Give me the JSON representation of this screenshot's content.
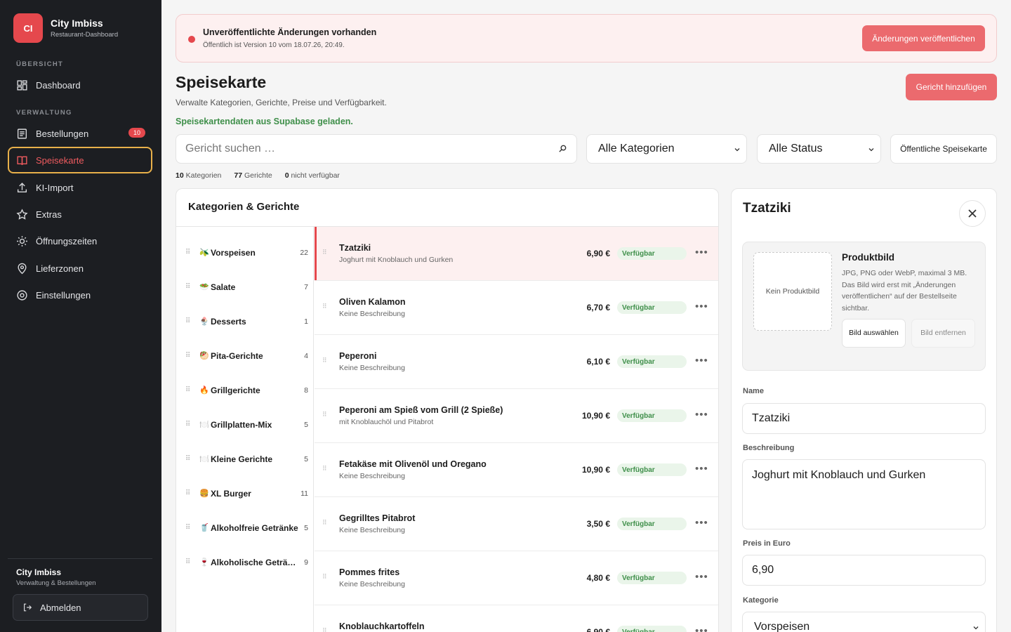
{
  "brand": {
    "logo": "CI",
    "name": "City Imbiss",
    "subtitle": "Restaurant-Dashboard"
  },
  "sidebar": {
    "section_overview": "ÜBERSICHT",
    "section_admin": "VERWALTUNG",
    "items": [
      {
        "label": "Dashboard",
        "icon": "dashboard-icon"
      },
      {
        "label": "Bestellungen",
        "icon": "receipt-icon",
        "badge": "10"
      },
      {
        "label": "Speisekarte",
        "icon": "book-icon",
        "active": true
      },
      {
        "label": "KI-Import",
        "icon": "upload-icon"
      },
      {
        "label": "Extras",
        "icon": "star-icon"
      },
      {
        "label": "Öffnungszeiten",
        "icon": "sun-icon"
      },
      {
        "label": "Lieferzonen",
        "icon": "map-pin-icon"
      },
      {
        "label": "Einstellungen",
        "icon": "gear-icon"
      }
    ],
    "footer_name": "City Imbiss",
    "footer_sub": "Verwaltung & Bestellungen",
    "logout": "Abmelden"
  },
  "banner": {
    "title": "Unveröffentlichte Änderungen vorhanden",
    "subtitle": "Öffentlich ist Version 10 vom 18.07.26, 20:49.",
    "button": "Änderungen veröffentlichen"
  },
  "page": {
    "title": "Speisekarte",
    "subtitle": "Verwalte Kategorien, Gerichte, Preise und Verfügbarkeit.",
    "status": "Speisekartendaten aus Supabase geladen.",
    "add_button": "Gericht hinzufügen"
  },
  "filters": {
    "search_placeholder": "Gericht suchen …",
    "category": "Alle Kategorien",
    "status": "Alle Status",
    "public_button": "Öffentliche Speisekarte"
  },
  "stats": {
    "categories_num": "10",
    "categories_label": "Kategorien",
    "dishes_num": "77",
    "dishes_label": "Gerichte",
    "unavailable_num": "0",
    "unavailable_label": "nicht verfügbar"
  },
  "list": {
    "title": "Kategorien & Gerichte",
    "categories": [
      {
        "emoji": "🫒",
        "name": "Vorspeisen",
        "count": "22"
      },
      {
        "emoji": "🥗",
        "name": "Salate",
        "count": "7"
      },
      {
        "emoji": "🍨",
        "name": "Desserts",
        "count": "1"
      },
      {
        "emoji": "🥙",
        "name": "Pita-Gerichte",
        "count": "4"
      },
      {
        "emoji": "🔥",
        "name": "Grillgerichte",
        "count": "8"
      },
      {
        "emoji": "🍽️",
        "name": "Grillplatten-Mix",
        "count": "5"
      },
      {
        "emoji": "🍽️",
        "name": "Kleine Gerichte",
        "count": "5"
      },
      {
        "emoji": "🍔",
        "name": "XL Burger",
        "count": "11"
      },
      {
        "emoji": "🥤",
        "name": "Alkoholfreie Getränke",
        "count": "5"
      },
      {
        "emoji": "🍷",
        "name": "Alkoholische Getränke",
        "count": "9"
      }
    ],
    "dishes": [
      {
        "name": "Tzatziki",
        "desc": "Joghurt mit Knoblauch und Gurken",
        "price": "6,90 €",
        "status": "Verfügbar",
        "selected": true
      },
      {
        "name": "Oliven Kalamon",
        "desc": "Keine Beschreibung",
        "price": "6,70 €",
        "status": "Verfügbar"
      },
      {
        "name": "Peperoni",
        "desc": "Keine Beschreibung",
        "price": "6,10 €",
        "status": "Verfügbar"
      },
      {
        "name": "Peperoni am Spieß vom Grill (2 Spieße)",
        "desc": "mit Knoblauchöl und Pitabrot",
        "price": "10,90 €",
        "status": "Verfügbar"
      },
      {
        "name": "Fetakäse mit Olivenöl und Oregano",
        "desc": "Keine Beschreibung",
        "price": "10,90 €",
        "status": "Verfügbar"
      },
      {
        "name": "Gegrilltes Pitabrot",
        "desc": "Keine Beschreibung",
        "price": "3,50 €",
        "status": "Verfügbar"
      },
      {
        "name": "Pommes frites",
        "desc": "Keine Beschreibung",
        "price": "4,80 €",
        "status": "Verfügbar"
      },
      {
        "name": "Knoblauchkartoffeln",
        "desc": "",
        "price": "6,90 €",
        "status": "Verfügbar"
      }
    ]
  },
  "detail": {
    "title": "Tzatziki",
    "image_title": "Produktbild",
    "no_image": "Kein Produktbild",
    "image_text": "JPG, PNG oder WebP, maximal 3 MB. Das Bild wird erst mit „Änderungen veröffentlichen“ auf der Bestellseite sichtbar.",
    "choose_image": "Bild auswählen",
    "remove_image": "Bild entfernen",
    "name_label": "Name",
    "name_value": "Tzatziki",
    "desc_label": "Beschreibung",
    "desc_value": "Joghurt mit Knoblauch und Gurken",
    "price_label": "Preis in Euro",
    "price_value": "6,90",
    "category_label": "Kategorie",
    "category_value": "Vorspeisen"
  },
  "colors": {
    "accent": "#e5484d",
    "sidebar": "#1c1e22",
    "available": "#3f8f4a",
    "focus": "#e8b04a"
  }
}
